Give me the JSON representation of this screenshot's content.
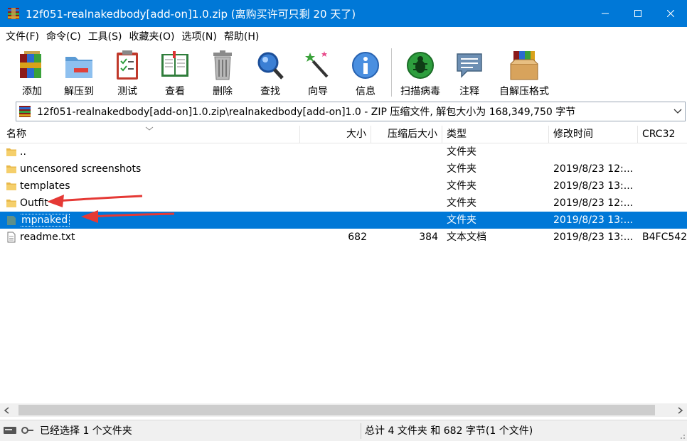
{
  "window": {
    "title": "12f051-realnakedbody[add-on]1.0.zip (离购买许可只剩 20 天了)",
    "controls": [
      "minimize",
      "maximize",
      "close"
    ]
  },
  "menu": [
    "文件(F)",
    "命令(C)",
    "工具(S)",
    "收藏夹(O)",
    "选项(N)",
    "帮助(H)"
  ],
  "toolbar": {
    "add": "添加",
    "extract_to": "解压到",
    "test": "测试",
    "view": "查看",
    "delete": "删除",
    "find": "查找",
    "wizard": "向导",
    "info": "信息",
    "virus_scan": "扫描病毒",
    "comment": "注释",
    "sfx": "自解压格式"
  },
  "address": {
    "path": "12f051-realnakedbody[add-on]1.0.zip\\realnakedbody[add-on]1.0 - ZIP 压缩文件, 解包大小为 168,349,750 字节"
  },
  "columns": {
    "name": "名称",
    "size": "大小",
    "packed": "压缩后大小",
    "type": "类型",
    "modified": "修改时间",
    "crc": "CRC32"
  },
  "files": [
    {
      "name": "..",
      "size": "",
      "packed": "",
      "type": "文件夹",
      "modified": "",
      "crc": "",
      "icon": "folder-icon",
      "selected": false
    },
    {
      "name": "uncensored screenshots",
      "size": "",
      "packed": "",
      "type": "文件夹",
      "modified": "2019/8/23 12:...",
      "crc": "",
      "icon": "folder-icon",
      "selected": false
    },
    {
      "name": "templates",
      "size": "",
      "packed": "",
      "type": "文件夹",
      "modified": "2019/8/23 13:...",
      "crc": "",
      "icon": "folder-icon",
      "selected": false
    },
    {
      "name": "Outfit",
      "size": "",
      "packed": "",
      "type": "文件夹",
      "modified": "2019/8/23 12:...",
      "crc": "",
      "icon": "folder-icon",
      "selected": false
    },
    {
      "name": "mpnaked",
      "size": "",
      "packed": "",
      "type": "文件夹",
      "modified": "2019/8/23 13:...",
      "crc": "",
      "icon": "folder-icon",
      "selected": true
    },
    {
      "name": "readme.txt",
      "size": "682",
      "packed": "384",
      "type": "文本文档",
      "modified": "2019/8/23 13:...",
      "crc": "B4FC542",
      "icon": "text-file-icon",
      "selected": false
    }
  ],
  "status": {
    "left": "已经选择 1 个文件夹",
    "right": "总计 4 文件夹 和 682 字节(1 个文件)"
  },
  "colors": {
    "titlebar": "#0078d7",
    "selection": "#0078d7",
    "annotation_arrow": "#e53935"
  }
}
